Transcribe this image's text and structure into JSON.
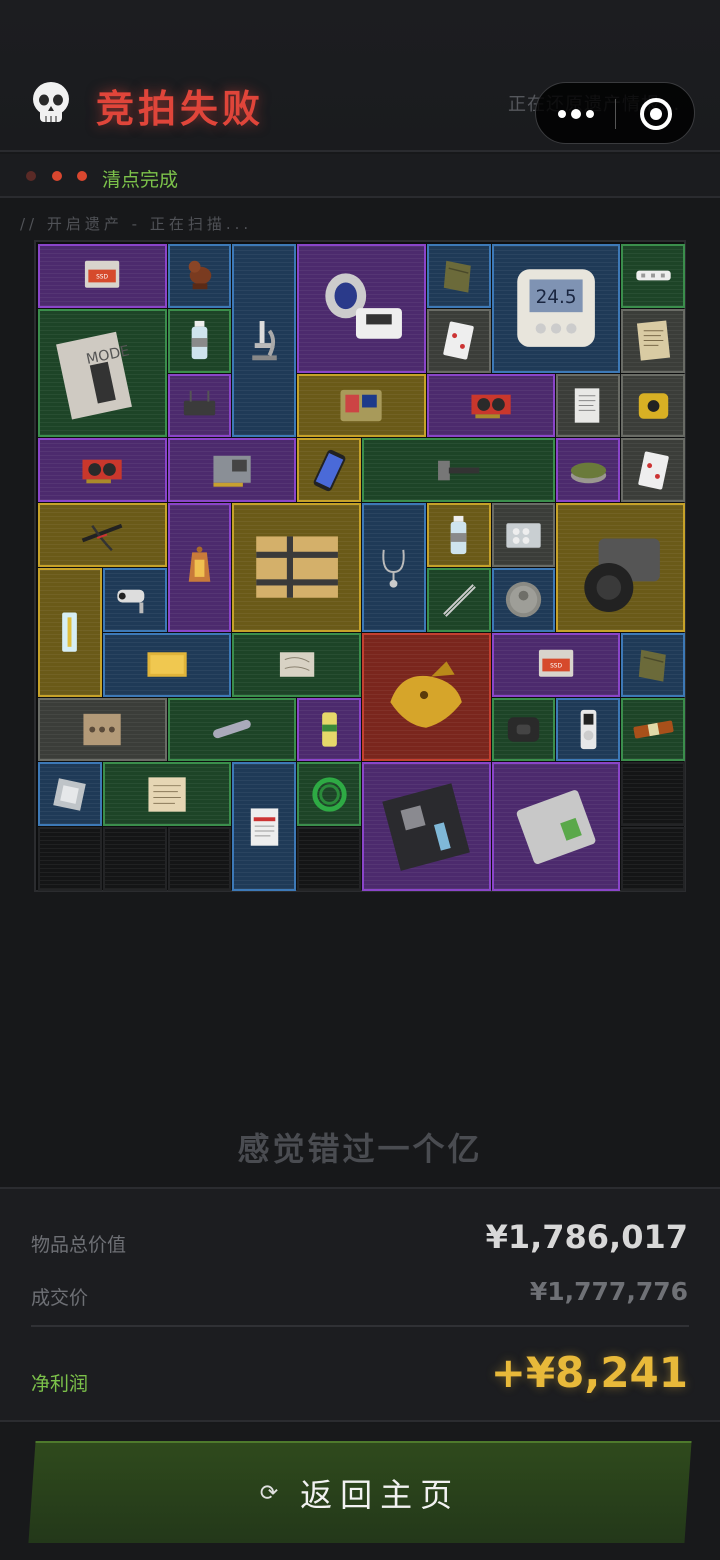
{
  "header": {
    "title": "竞拍失败",
    "restoring_text": "正在还原遗产情报..."
  },
  "status": {
    "text": "清点完成",
    "dot_colors": [
      "#5a2a26",
      "#d9472f",
      "#d9472f"
    ]
  },
  "scan": {
    "text": "// 开启遗产 - 正在扫描..."
  },
  "items": [
    {
      "name": "ssd-package",
      "rarity": "purple",
      "icon": "ssd-package-icon"
    },
    {
      "name": "wooden-bird",
      "rarity": "blue",
      "icon": "bird-statue-icon"
    },
    {
      "name": "microscope",
      "rarity": "blue",
      "icon": "microscope-icon"
    },
    {
      "name": "blood-pressure-monitor",
      "rarity": "purple",
      "icon": "bp-monitor-icon"
    },
    {
      "name": "ration-pack",
      "rarity": "blue",
      "icon": "pouch-icon"
    },
    {
      "name": "digital-thermometer",
      "rarity": "blue",
      "icon": "thermometer-display-icon"
    },
    {
      "name": "power-strip",
      "rarity": "green",
      "icon": "power-strip-icon"
    },
    {
      "name": "mode-magazine",
      "rarity": "green",
      "icon": "magazine-icon"
    },
    {
      "name": "water-bottle",
      "rarity": "green",
      "icon": "bottle-icon"
    },
    {
      "name": "playing-cards",
      "rarity": "grey",
      "icon": "cards-icon"
    },
    {
      "name": "old-letter",
      "rarity": "grey",
      "icon": "paper-icon"
    },
    {
      "name": "router",
      "rarity": "purple",
      "icon": "router-icon"
    },
    {
      "name": "military-terminal",
      "rarity": "gold",
      "icon": "terminal-icon"
    },
    {
      "name": "graphics-card",
      "rarity": "purple",
      "icon": "gpu-icon"
    },
    {
      "name": "receipts",
      "rarity": "grey",
      "icon": "receipt-icon"
    },
    {
      "name": "tape-measure",
      "rarity": "grey",
      "icon": "tape-icon"
    },
    {
      "name": "graphics-card-2",
      "rarity": "purple",
      "icon": "gpu-icon"
    },
    {
      "name": "capture-card",
      "rarity": "purple",
      "icon": "pcb-icon"
    },
    {
      "name": "smartphone",
      "rarity": "gold",
      "icon": "phone-icon"
    },
    {
      "name": "sledgehammer",
      "rarity": "green",
      "icon": "hammer-icon"
    },
    {
      "name": "food-tin",
      "rarity": "purple",
      "icon": "tin-icon"
    },
    {
      "name": "playing-card-2",
      "rarity": "grey",
      "icon": "cards-icon"
    },
    {
      "name": "crossbow",
      "rarity": "gold",
      "icon": "crossbow-icon"
    },
    {
      "name": "lantern",
      "rarity": "purple",
      "icon": "lantern-icon"
    },
    {
      "name": "supply-crate",
      "rarity": "gold",
      "icon": "crate-icon"
    },
    {
      "name": "stethoscope",
      "rarity": "blue",
      "icon": "stethoscope-icon"
    },
    {
      "name": "small-bottle",
      "rarity": "gold",
      "icon": "bottle-icon"
    },
    {
      "name": "pill-blister",
      "rarity": "grey",
      "icon": "blister-icon"
    },
    {
      "name": "camera",
      "rarity": "gold",
      "icon": "camera-icon"
    },
    {
      "name": "syringe-pack",
      "rarity": "gold",
      "icon": "syringe-icon"
    },
    {
      "name": "cctv-camera",
      "rarity": "blue",
      "icon": "cctv-icon"
    },
    {
      "name": "tweezers",
      "rarity": "green",
      "icon": "tweezers-icon"
    },
    {
      "name": "ancient-coin",
      "rarity": "blue",
      "icon": "coin-icon"
    },
    {
      "name": "gold-bar",
      "rarity": "blue",
      "icon": "gold-bar-icon"
    },
    {
      "name": "old-map",
      "rarity": "green",
      "icon": "map-icon"
    },
    {
      "name": "golden-crocodile-statue",
      "rarity": "red",
      "icon": "statue-icon"
    },
    {
      "name": "ssd-package-2",
      "rarity": "purple",
      "icon": "ssd-package-icon"
    },
    {
      "name": "ration-pack-2",
      "rarity": "blue",
      "icon": "pouch-icon"
    },
    {
      "name": "old-photo",
      "rarity": "grey",
      "icon": "photo-icon"
    },
    {
      "name": "glass-tube",
      "rarity": "green",
      "icon": "tube-icon"
    },
    {
      "name": "energy-drink",
      "rarity": "purple",
      "icon": "can-icon"
    },
    {
      "name": "power-bank",
      "rarity": "green",
      "icon": "power-bank-icon"
    },
    {
      "name": "mp3-player",
      "rarity": "blue",
      "icon": "mp3-icon"
    },
    {
      "name": "snack-bar",
      "rarity": "green",
      "icon": "snack-icon"
    },
    {
      "name": "cpu-chip",
      "rarity": "blue",
      "icon": "cpu-icon"
    },
    {
      "name": "parchment",
      "rarity": "green",
      "icon": "parchment-icon"
    },
    {
      "name": "confidential-file",
      "rarity": "blue",
      "icon": "clipboard-icon"
    },
    {
      "name": "green-hose",
      "rarity": "green",
      "icon": "hose-icon"
    },
    {
      "name": "motherboard",
      "rarity": "purple",
      "icon": "motherboard-icon"
    },
    {
      "name": "external-ssd",
      "rarity": "purple",
      "icon": "external-drive-icon"
    }
  ],
  "slogan": "感觉错过一个亿",
  "summary": {
    "total_label": "物品总价值",
    "total_value": "¥1,786,017",
    "deal_label": "成交价",
    "deal_value": "¥1,777,776",
    "profit_label": "净利润",
    "profit_value": "+¥8,241"
  },
  "colors": {
    "title": "#e0453a",
    "accent_green": "#7cc24a",
    "profit_gold": "#e8b93a"
  },
  "home_button": {
    "label": "返回主页",
    "icon": "refresh-icon"
  }
}
